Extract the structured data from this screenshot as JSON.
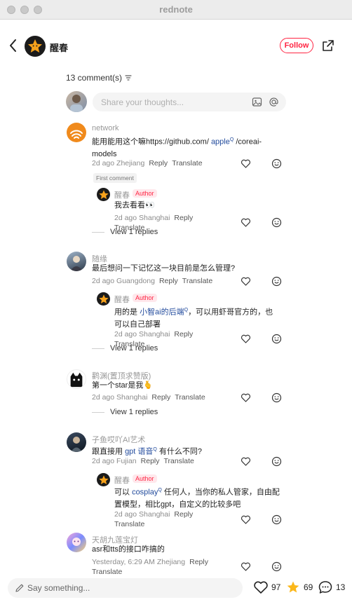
{
  "window": {
    "title": "rednote"
  },
  "header": {
    "author": "醒春",
    "follow_label": "Follow"
  },
  "comments_count_label": "13 comment(s)",
  "share_input": {
    "placeholder": "Share your thoughts..."
  },
  "first_comment_tag": "First comment",
  "author_tag": "Author",
  "reply_label": "Reply",
  "translate_label": "Translate",
  "comments": [
    {
      "user": "network",
      "text_a": "能用能用这个嘛https://github.com/ ",
      "link": "apple",
      "text_b": " /coreai-",
      "text_c": "models",
      "date": "2d ago",
      "location": "Zhejiang",
      "reply": {
        "user": "醒春",
        "text": "我去看看👀",
        "date": "2d ago",
        "location": "Shanghai"
      },
      "view_replies": "View 1 replies"
    },
    {
      "user": "随缘",
      "text": "最后想问一下记忆这一块目前是怎么管理?",
      "date": "2d ago",
      "location": "Guangdong",
      "reply": {
        "user": "醒春",
        "text_a": "用的是 ",
        "link": "小智ai的后端",
        "text_b": "，可以用虾哥官方的，也",
        "text_c": "可以自己部署",
        "date": "2d ago",
        "location": "Shanghai"
      },
      "view_replies": "View 1 replies"
    },
    {
      "user": "鹳渊(置顶求赞版)",
      "text": "第一个star是我🫰",
      "date": "2d ago",
      "location": "Shanghai",
      "view_replies": "View 1 replies"
    },
    {
      "user": "子鱼哎吖AI艺术",
      "text_a": "跟直接用 ",
      "link": "gpt 语音",
      "text_b": " 有什么不同?",
      "date": "2d ago",
      "location": "Fujian",
      "reply": {
        "user": "醒春",
        "text_a": "可以 ",
        "link": "cosplay",
        "text_b": " 任何人，当你的私人管家，自由配",
        "text_c": "置模型，相比gpt，自定义的比较多吧",
        "date": "2d ago",
        "location": "Shanghai"
      }
    },
    {
      "user": "天胡九莲宝灯",
      "text": "asr和tts的接口咋搞的",
      "date": "Yesterday, 6:29 AM",
      "location": "Zhejiang"
    }
  ],
  "bottom_bar": {
    "placeholder": "Say something...",
    "likes": "97",
    "stars": "69",
    "comments": "13"
  }
}
